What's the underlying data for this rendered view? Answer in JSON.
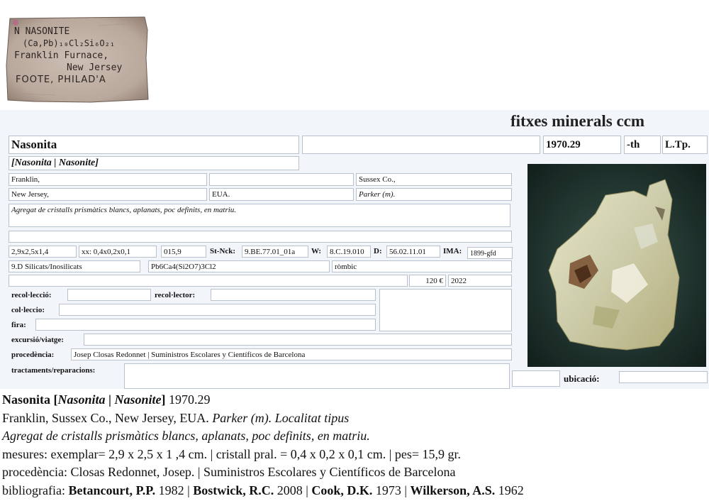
{
  "old_label": {
    "line1": "N  NASONITE",
    "line2": "(Ca,Pb)₁₀Cl₂Si₆O₂₁",
    "line3": "Franklin Furnace,",
    "line4": "New Jersey",
    "line5": "FOOTE, PHILAD'A"
  },
  "header": {
    "brand": "fitxes minerals ccm"
  },
  "card": {
    "name": "Nasonita",
    "synonyms": "[Nasonita | Nasonite]",
    "extra_field": "",
    "catalog_no": "1970.29",
    "th": "-th",
    "ltp": "L.Tp.",
    "locality1": "Franklin,",
    "locality2": "",
    "county": "Sussex Co.,",
    "state": "New Jersey,",
    "country": "EUA.",
    "collector_locality": "Parker (m).",
    "description": "Agregat de cristalls prismàtics blancs, aplanats, poc definits, en matriu.",
    "notes": "",
    "size": "2,9x2,5x1,4",
    "crystal": "xx: 0,4x0,2x0,1",
    "weight": "015,9",
    "st_nck_label": "St-Nck:",
    "st_nck": "9.BE.77.01_01a",
    "w_label": "W:",
    "w_value": "8.C.19.010",
    "d_label": "D:",
    "d_value": "56.02.11.01",
    "ima_label": "IMA:",
    "ima_value": "1899-gfd",
    "class": "9.D Silicats/Inosilicats",
    "formula": "Pb6Ca4(Si2O7)3Cl2",
    "system": "ròmbic",
    "price": "120 €",
    "year": "2022",
    "recollection_label": "recol·lecció:",
    "recollection": "",
    "recollector_label": "recol·lector:",
    "recollector": "",
    "collection_label": "col·leccio:",
    "collection": "",
    "fair_label": "fira:",
    "fair": "",
    "excursion_label": "excursió/viatge:",
    "excursion": "",
    "provenance_label": "procedència:",
    "provenance": "Josep Closas Redonnet | Suministros Escolares y Científicos de Barcelona",
    "treatments_label": "tractaments/reparacions:",
    "treatments": "",
    "location_label": "ubicació:",
    "location": ""
  },
  "summary": {
    "name": "Nasonita",
    "syn_open": "[",
    "syn1": "Nasonita",
    "syn_sep": " | ",
    "syn2": "Nasonite",
    "syn_close": "]",
    "catalog": "1970.29",
    "locality": "Franklin, Sussex Co., New Jersey, EUA.",
    "locality_note": "Parker (m). Localitat tipus",
    "description": "Agregat de cristalls prismàtics blancs, aplanats, poc definits, en matriu.",
    "measures": "mesures: exemplar= 2,9 x 2,5 x 1 ,4 cm. | cristall pral. = 0,4 x 0,2 x 0,1 cm. | pes= 15,9 gr.",
    "provenance": "procedència: Closas Redonnet, Josep. | Suministros Escolares y Científicos de Barcelona",
    "biblio_label": "bibliografia:",
    "refs": [
      {
        "author": "Betancourt, P.P.",
        "year": "1982"
      },
      {
        "author": "Bostwick, R.C.",
        "year": "2008"
      },
      {
        "author": "Cook, D.K.",
        "year": "1973"
      },
      {
        "author": "Wilkerson, A.S.",
        "year": "1962"
      }
    ],
    "ref_sep": " | "
  }
}
